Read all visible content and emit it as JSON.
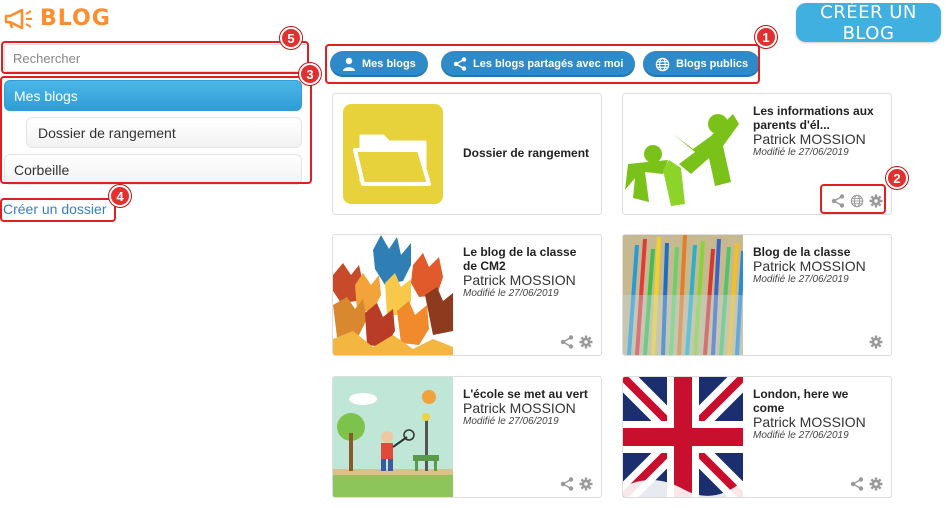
{
  "header": {
    "title": "BLOG",
    "create_blog_label": "CRÉER UN BLOG"
  },
  "search": {
    "placeholder": "Rechercher"
  },
  "sidebar": {
    "items": [
      {
        "label": "Mes blogs"
      },
      {
        "label": "Dossier de rangement"
      },
      {
        "label": "Corbeille"
      }
    ],
    "create_folder_label": "Créer un dossier"
  },
  "filters": {
    "mine": "Mes blogs",
    "shared": "Les blogs partagés avec moi",
    "public": "Blogs publics"
  },
  "annotations": [
    "1",
    "2",
    "3",
    "4",
    "5"
  ],
  "folder_card": {
    "title": "Dossier de rangement"
  },
  "cards": [
    {
      "title": "Les informations aux parents d'él...",
      "author": "Patrick MOSSION",
      "date": "Modifié le 27/06/2019"
    },
    {
      "title": "Le blog de la classe de CM2",
      "author": "Patrick MOSSION",
      "date": "Modifié le 27/06/2019"
    },
    {
      "title": "Blog de la classe",
      "author": "Patrick MOSSION",
      "date": "Modifié le 27/06/2019"
    },
    {
      "title": "L'école se met au vert",
      "author": "Patrick MOSSION",
      "date": "Modifié le 27/06/2019"
    },
    {
      "title": "London, here we come",
      "author": "Patrick MOSSION",
      "date": "Modifié le 27/06/2019"
    }
  ],
  "colors": {
    "accent": "#2f8ac9",
    "brand": "#ff8d2e",
    "annotation": "#e02020"
  }
}
